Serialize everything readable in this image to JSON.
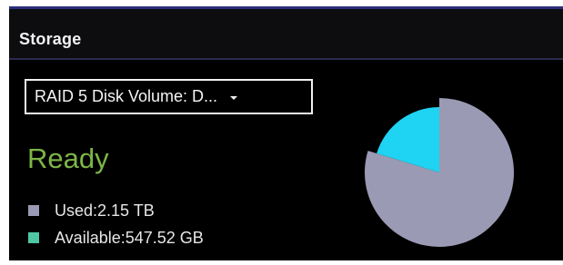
{
  "widget": {
    "title": "Storage",
    "volume_select": {
      "selected": "RAID 5 Disk Volume: D...",
      "icon": "chevron-down-icon"
    },
    "status": "Ready"
  },
  "colors": {
    "used": "#9a9ab5",
    "available": "#1fd3f2",
    "available_swatch": "#4fc7a4",
    "status": "#7db645"
  },
  "legend": {
    "used_label": "Used:2.15 TB",
    "available_label": "Available:547.52 GB"
  },
  "chart_data": {
    "type": "pie",
    "slices": [
      {
        "label": "Used",
        "value": 2.15,
        "unit": "TB"
      },
      {
        "label": "Available",
        "value": 0.54752,
        "unit": "TB"
      }
    ]
  }
}
